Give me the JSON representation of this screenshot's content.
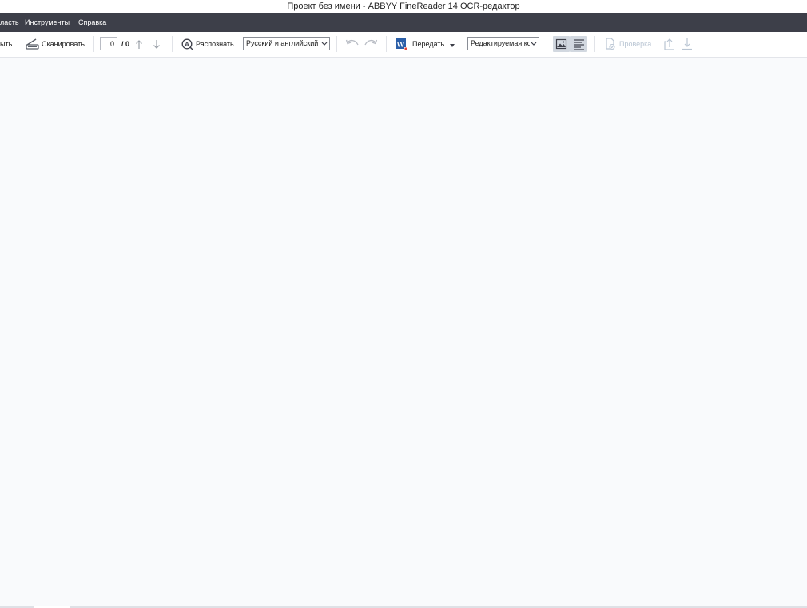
{
  "window": {
    "title": "Проект без имени - ABBYY FineReader 14 OCR-редактор"
  },
  "menu": {
    "items": [
      {
        "label": "ласть"
      },
      {
        "label": "Инструменты"
      },
      {
        "label": "Справка"
      }
    ]
  },
  "toolbar": {
    "open_label": "ыть",
    "scan_label": "Сканировать",
    "page_current": "0",
    "page_total": "/ 0",
    "recognize_label": "Распознать",
    "language_value": "Русский и английский",
    "send_label": "Передать",
    "mode_value": "Редактируемая ког",
    "verify_label": "Проверка"
  },
  "icons": {
    "scan": "scanner-icon",
    "prev_page": "arrow-up-icon",
    "next_page": "arrow-down-icon",
    "recognize": "recognize-icon",
    "undo": "undo-icon",
    "redo": "redo-icon",
    "word": "word-icon",
    "image_view": "image-view-icon",
    "text_view": "text-view-icon",
    "verify": "verify-icon",
    "export_up": "export-up-icon",
    "export_down": "export-down-icon"
  },
  "colors": {
    "menubar_bg": "#3d3f49",
    "workspace_bg": "#f9fafc",
    "toggle_active_bg": "#d2d8e0",
    "word_blue": "#2b5fa8",
    "icon_gray": "#5a5f68",
    "disabled": "#b9c5d3"
  }
}
